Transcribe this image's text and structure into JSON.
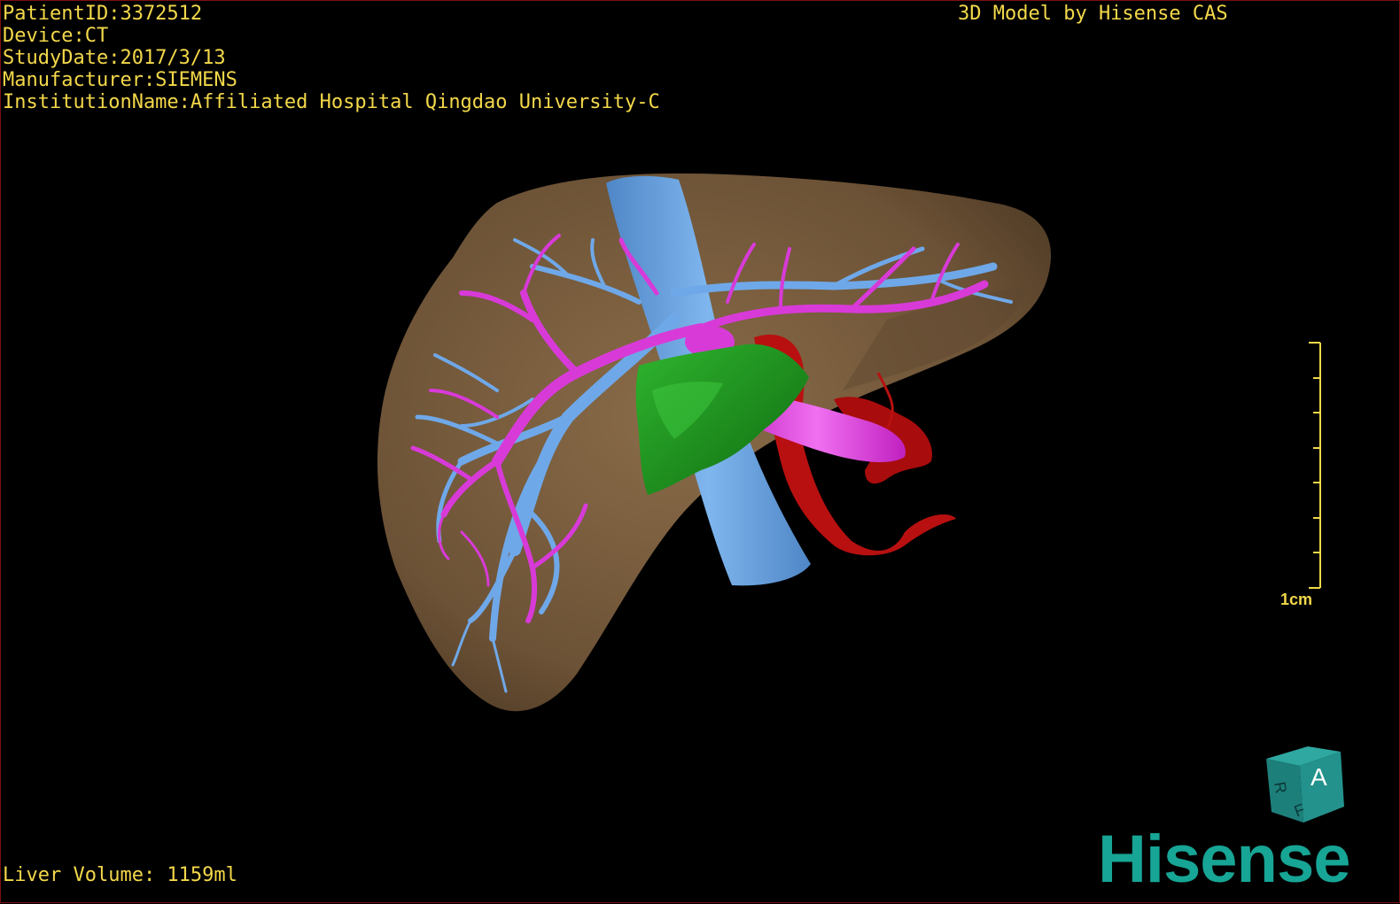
{
  "patient_info": {
    "patient_id": "PatientID:3372512",
    "device": "Device:CT",
    "study_date": "StudyDate:2017/3/13",
    "manufacturer": "Manufacturer:SIEMENS",
    "institution": "InstitutionName:Affiliated Hospital Qingdao University-C"
  },
  "credit": "3D Model by Hisense CAS",
  "liver_volume": "Liver Volume: 1159ml",
  "scale_bar": {
    "label": "1cm",
    "ticks": 8
  },
  "orientation_cube": {
    "front_label": "A",
    "side_label_1": "R",
    "side_label_2": "F"
  },
  "brand": "Hisense",
  "colors": {
    "overlay_text": "#f3d84a",
    "liver": "#7a5f3f",
    "portal_vein": "#6fa8e8",
    "hepatic_vein": "#d83ad8",
    "tumor": "#1f9a1f",
    "artery": "#b81010",
    "brand": "#17a595"
  }
}
